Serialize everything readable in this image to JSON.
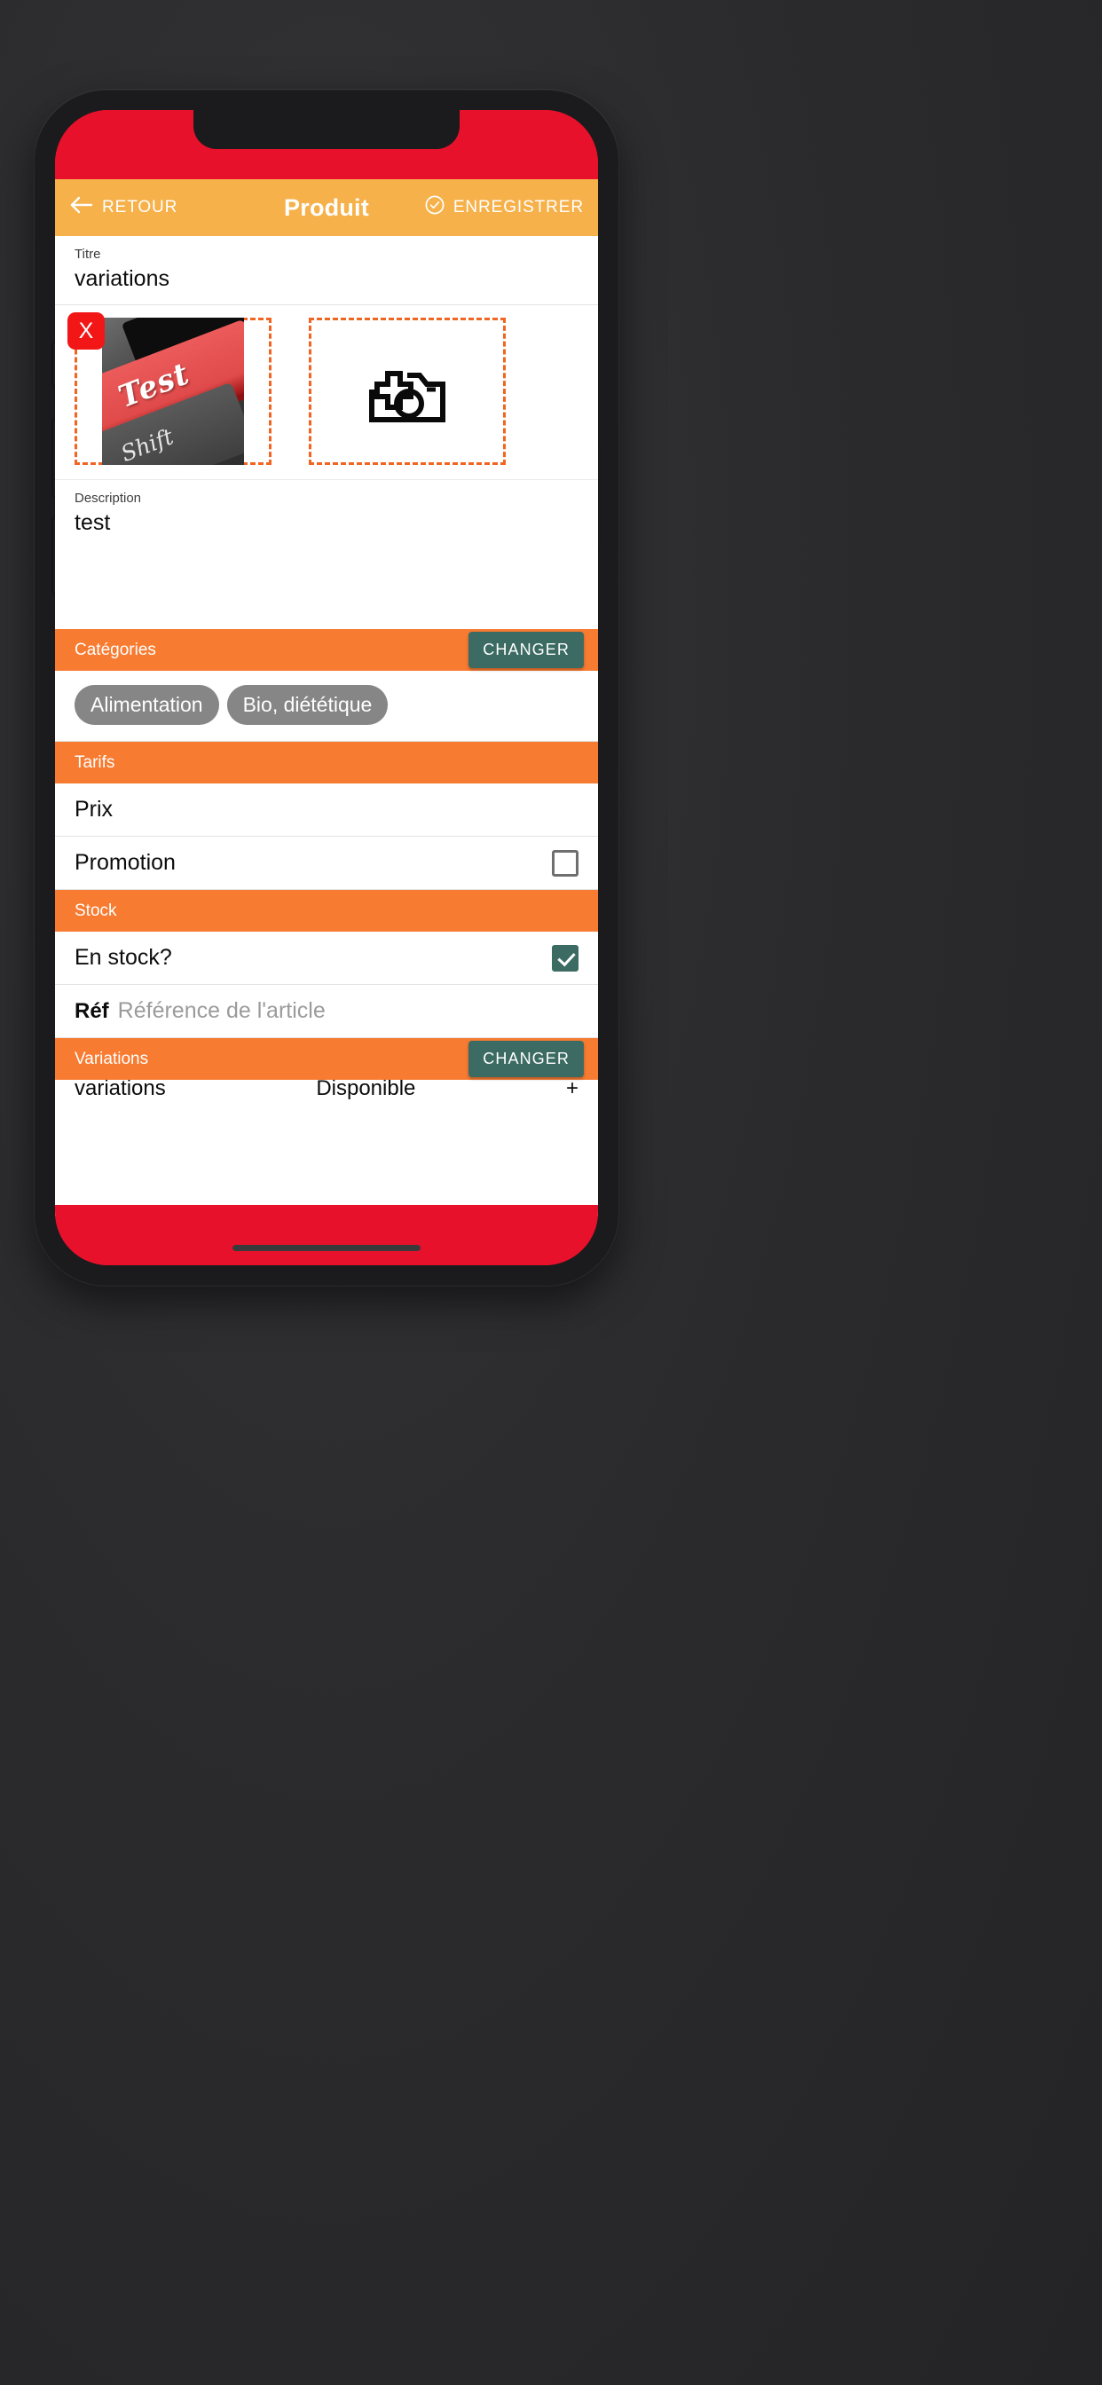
{
  "appbar": {
    "back_label": "RETOUR",
    "title": "Produit",
    "save_label": "ENREGISTRER",
    "back_icon": "arrow-left-icon",
    "save_icon": "check-circle-icon"
  },
  "fields": {
    "title_label": "Titre",
    "title_value": "variations",
    "description_label": "Description",
    "description_value": "test"
  },
  "images": {
    "remove_label": "X",
    "add_icon": "camera-plus-icon",
    "photo_alt_top": "/",
    "photo_alt_main": "Test",
    "photo_alt_bottom": "Shift"
  },
  "sections": {
    "categories": {
      "title": "Catégories",
      "change_label": "CHANGER"
    },
    "tarifs": {
      "title": "Tarifs"
    },
    "stock": {
      "title": "Stock"
    },
    "variations": {
      "title": "Variations",
      "change_label": "CHANGER"
    }
  },
  "categories": {
    "chips": [
      "Alimentation",
      "Bio, diététique"
    ]
  },
  "tarifs": {
    "price_label": "Prix",
    "price_value": "",
    "promotion_label": "Promotion",
    "promotion_checked": false
  },
  "stock": {
    "in_stock_label": "En stock?",
    "in_stock_checked": true,
    "ref_label": "Réf",
    "ref_placeholder": "Référence de l'article"
  },
  "variations_preview": {
    "left": "variations",
    "middle": "Disponible",
    "right": "+"
  },
  "colors": {
    "appbar": "#F6B14A",
    "section": "#F77B31",
    "accent_teal": "#3C6B63",
    "dashed_border": "#F06522",
    "remove_red": "#F31616",
    "device_red": "#E8112B",
    "chip_gray": "#868686"
  }
}
